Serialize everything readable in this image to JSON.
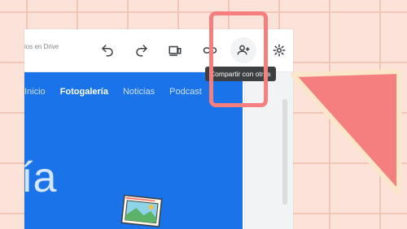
{
  "toolbar": {
    "drive_status": "ios en Drive",
    "buttons": [
      {
        "name": "undo",
        "icon": "undo-icon"
      },
      {
        "name": "redo",
        "icon": "redo-icon"
      },
      {
        "name": "preview",
        "icon": "device-preview-icon"
      },
      {
        "name": "link",
        "icon": "link-icon"
      },
      {
        "name": "share",
        "icon": "add-person-icon"
      },
      {
        "name": "settings",
        "icon": "gear-icon"
      }
    ]
  },
  "tooltip": {
    "text": "Compartir con otros"
  },
  "site": {
    "nav": [
      "Inicio",
      "Fotogalería",
      "Noticias",
      "Podcast"
    ],
    "active_nav": "Fotogalería",
    "hero_fragment": "ía"
  },
  "colors": {
    "background": "#fbe3da",
    "site_primary": "#1a73e8",
    "highlight": "#f57f7f",
    "tooltip_bg": "#3c4043"
  }
}
